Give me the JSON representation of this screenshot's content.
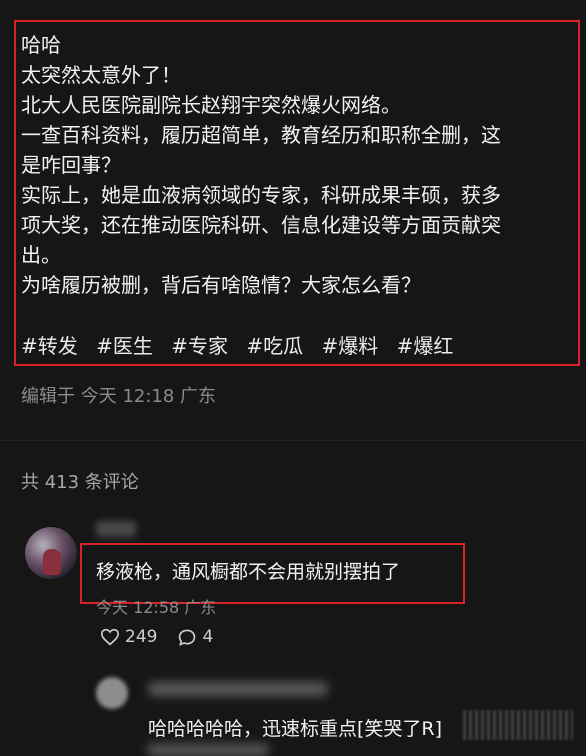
{
  "post": {
    "lines": [
      "哈哈",
      "太突然太意外了！",
      "北大人民医院副院长赵翔宇突然爆火网络。",
      "一查百科资料，履历超简单，教育经历和职称全删，这",
      "是咋回事？",
      "实际上，她是血液病领域的专家，科研成果丰硕，获多",
      "项大奖，还在推动医院科研、信息化建设等方面贡献突",
      "出。",
      "为啥履历被删，背后有啥隐情？大家怎么看？"
    ],
    "tags": [
      "#转发",
      "#医生",
      "#专家",
      "#吃瓜",
      "#爆料",
      "#爆红"
    ],
    "meta": "编辑于 今天 12:18 广东"
  },
  "comments_header": "共 413 条评论",
  "comment": {
    "text": "移液枪，通风橱都不会用就别摆拍了",
    "time": "今天 12:58 广东",
    "likes": "249",
    "replies": "4"
  },
  "reply": {
    "text": "哈哈哈哈哈，迅速标重点[笑哭了R]"
  },
  "colors": {
    "highlight_border": "#d8232a",
    "background": "#161616"
  }
}
